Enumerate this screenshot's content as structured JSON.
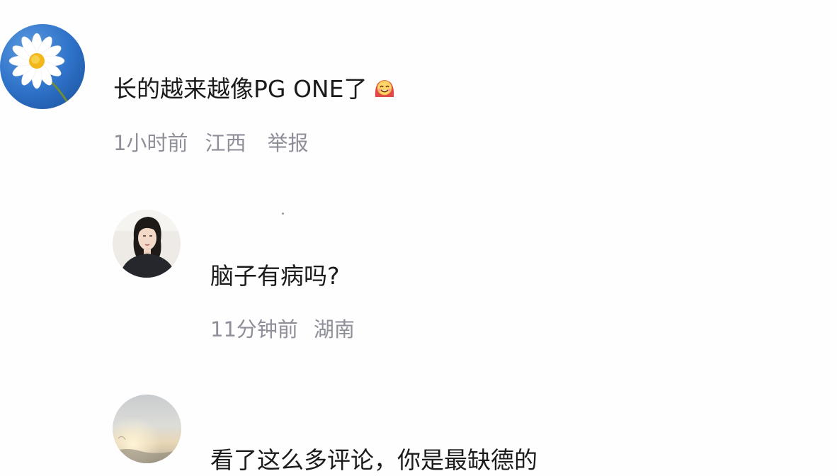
{
  "comments": [
    {
      "avatar_icon": "daisy-flower-avatar",
      "text": "长的越来越像PG ONE了",
      "emoji_icon": "smiling-face-emoji",
      "time": "1小时前",
      "location": "江西",
      "report_label": "举报"
    },
    {
      "avatar_icon": "woman-portrait-avatar",
      "text": "脑子有病吗?",
      "time": "11分钟前",
      "location": "湖南"
    },
    {
      "avatar_icon": "sky-landscape-avatar",
      "text": "看了这么多评论，你是最缺德的"
    }
  ]
}
